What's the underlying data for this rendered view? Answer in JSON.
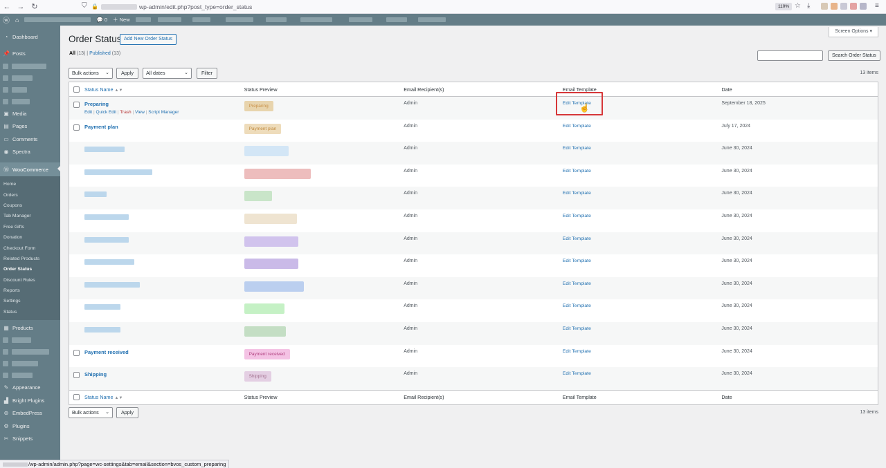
{
  "browser": {
    "url_path": "wp-admin/edit.php?post_type=order_status",
    "zoom": "110%"
  },
  "admin_bar": {
    "comments_count": "0",
    "new_label": "New"
  },
  "sidebar": {
    "top_items": [
      {
        "label": "Dashboard",
        "icon": "dashboard-icon"
      },
      {
        "label": "Posts",
        "icon": "pin-icon"
      }
    ],
    "mid_items": [
      {
        "label": "Media",
        "icon": "media-icon"
      },
      {
        "label": "Pages",
        "icon": "pages-icon"
      },
      {
        "label": "Comments",
        "icon": "comments-icon"
      },
      {
        "label": "Spectra",
        "icon": "spectra-icon"
      }
    ],
    "woocommerce": "WooCommerce",
    "submenu": [
      "Home",
      "Orders",
      "Coupons",
      "Tab Manager",
      "Free Gifts",
      "Donation",
      "Checkout Form",
      "Related Products",
      "Order Status",
      "Discount Rules",
      "Reports",
      "Settings",
      "Status"
    ],
    "current_submenu": "Order Status",
    "products": "Products",
    "bottom_items": [
      {
        "label": "Appearance",
        "icon": "brush-icon"
      },
      {
        "label": "Bright Plugins",
        "icon": "chart-icon"
      },
      {
        "label": "EmbedPress",
        "icon": "embed-icon"
      },
      {
        "label": "Plugins",
        "icon": "plugin-icon"
      },
      {
        "label": "Snippets",
        "icon": "scissors-icon"
      }
    ]
  },
  "page": {
    "title": "Order Status",
    "add_new": "Add New Order Status",
    "screen_options": "Screen Options",
    "filter_all": "All",
    "filter_all_count": "(13)",
    "filter_published": "Published",
    "filter_published_count": "(13)",
    "search_button": "Search Order Status",
    "bulk_actions": "Bulk actions",
    "apply": "Apply",
    "all_dates": "All dates",
    "filter": "Filter",
    "items_count": "13 items"
  },
  "table": {
    "columns": {
      "name": "Status Name",
      "preview": "Status Preview",
      "recipient": "Email Recipient(s)",
      "template": "Email Template",
      "date": "Date"
    },
    "row_actions": {
      "edit": "Edit",
      "quick_edit": "Quick Edit",
      "trash": "Trash",
      "view": "View",
      "script_manager": "Script Manager"
    },
    "rows": [
      {
        "name": "Preparing",
        "badge": "Preparing",
        "badge_bg": "#e8d4ad",
        "badge_fg": "#c9924a",
        "recipient": "Admin",
        "template": "Edit Template",
        "date": "September 18, 2025",
        "blurred": false
      },
      {
        "name": "Payment plan",
        "badge": "Payment plan",
        "badge_bg": "#eedcbb",
        "badge_fg": "#c08a3e",
        "recipient": "Admin",
        "template": "Edit Template",
        "date": "July 17, 2024",
        "blurred": false
      },
      {
        "name": "",
        "badge": "",
        "badge_bg": "#c7e0f6",
        "recipient": "Admin",
        "template": "Edit Template",
        "date": "June 30, 2024",
        "blurred": true
      },
      {
        "name": "",
        "badge": "",
        "badge_bg": "#e7a7a7",
        "recipient": "Admin",
        "template": "Edit Template",
        "date": "June 30, 2024",
        "blurred": true
      },
      {
        "name": "",
        "badge": "",
        "badge_bg": "#b9dfb9",
        "recipient": "Admin",
        "template": "Edit Template",
        "date": "June 30, 2024",
        "blurred": true
      },
      {
        "name": "",
        "badge": "",
        "badge_bg": "#eadbc2",
        "recipient": "Admin",
        "template": "Edit Template",
        "date": "June 30, 2024",
        "blurred": true
      },
      {
        "name": "",
        "badge": "",
        "badge_bg": "#c4b2ea",
        "recipient": "Admin",
        "template": "Edit Template",
        "date": "June 30, 2024",
        "blurred": true
      },
      {
        "name": "",
        "badge": "",
        "badge_bg": "#b8a3e0",
        "recipient": "Admin",
        "template": "Edit Template",
        "date": "June 30, 2024",
        "blurred": true
      },
      {
        "name": "",
        "badge": "",
        "badge_bg": "#a7c2ec",
        "recipient": "Admin",
        "template": "Edit Template",
        "date": "June 30, 2024",
        "blurred": true
      },
      {
        "name": "",
        "badge": "",
        "badge_bg": "#b2ecb2",
        "recipient": "Admin",
        "template": "Edit Template",
        "date": "June 30, 2024",
        "blurred": true
      },
      {
        "name": "",
        "badge": "",
        "badge_bg": "#b3d6b3",
        "recipient": "Admin",
        "template": "Edit Template",
        "date": "June 30, 2024",
        "blurred": true
      },
      {
        "name": "Payment received",
        "badge": "Payment received",
        "badge_bg": "#f4c2e4",
        "badge_fg": "#b1407f",
        "recipient": "Admin",
        "template": "Edit Template",
        "date": "June 30, 2024",
        "blurred": false
      },
      {
        "name": "Shipping",
        "badge": "Shipping",
        "badge_bg": "#e4cfe3",
        "badge_fg": "#a2708e",
        "recipient": "Admin",
        "template": "Edit Template",
        "date": "June 30, 2024",
        "blurred": false
      }
    ]
  },
  "status_bar": {
    "url": "/wp-admin/admin.php?page=wc-settings&tab=email&section=bvos_custom_preparing"
  },
  "colors": {
    "admin_bg": "#647d87",
    "link": "#2271b1",
    "highlight": "#d63638"
  }
}
